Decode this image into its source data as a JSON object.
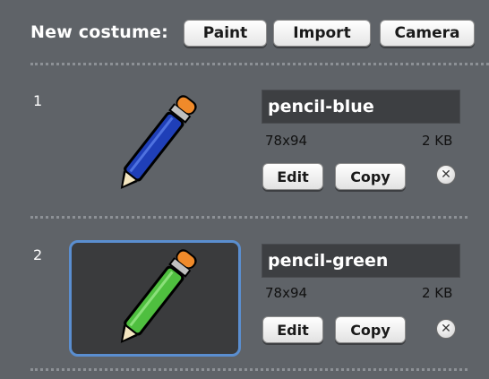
{
  "header": {
    "label": "New costume:",
    "buttons": {
      "paint": "Paint",
      "import": "Import",
      "camera": "Camera"
    }
  },
  "costumes": [
    {
      "number": "1",
      "name": "pencil-blue",
      "dimensions": "78x94",
      "size": "2 KB",
      "edit_label": "Edit",
      "copy_label": "Copy",
      "color": "#1f3fb8",
      "selected": false
    },
    {
      "number": "2",
      "name": "pencil-green",
      "dimensions": "78x94",
      "size": "2 KB",
      "edit_label": "Edit",
      "copy_label": "Copy",
      "color": "#4fbf3f",
      "selected": true
    }
  ],
  "delete_icon": "close-icon",
  "colors": {
    "panel_bg": "#5f6368",
    "selection_border": "#5a8ed0",
    "eraser": "#f08a2a"
  }
}
